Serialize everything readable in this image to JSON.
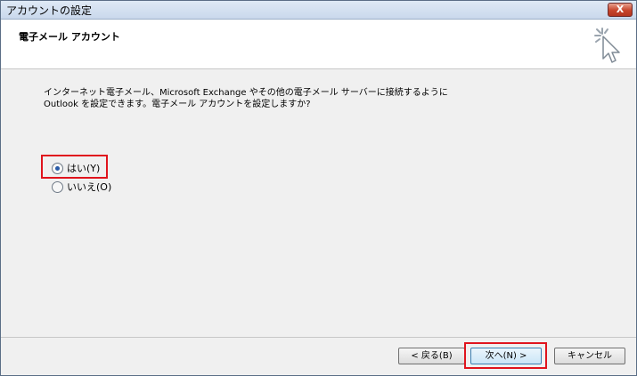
{
  "window": {
    "title": "アカウントの設定",
    "close_label": "X"
  },
  "header": {
    "title": "電子メール アカウント"
  },
  "content": {
    "description_line1": "インターネット電子メール、Microsoft Exchange やその他の電子メール サーバーに接続するように",
    "description_line2": "Outlook を設定できます。電子メール アカウントを設定しますか?",
    "options": [
      {
        "label": "はい(Y)",
        "checked": true
      },
      {
        "label": "いいえ(O)",
        "checked": false
      }
    ]
  },
  "buttons": {
    "back": "< 戻る(B)",
    "next": "次へ(N) >",
    "cancel": "キャンセル"
  },
  "colors": {
    "highlight": "#e0141d",
    "title_bar": "#c9d8ec",
    "radio_dot": "#2a5ba8"
  },
  "icons": {
    "header_icon": "wizard-cursor-icon",
    "close": "close-icon"
  }
}
